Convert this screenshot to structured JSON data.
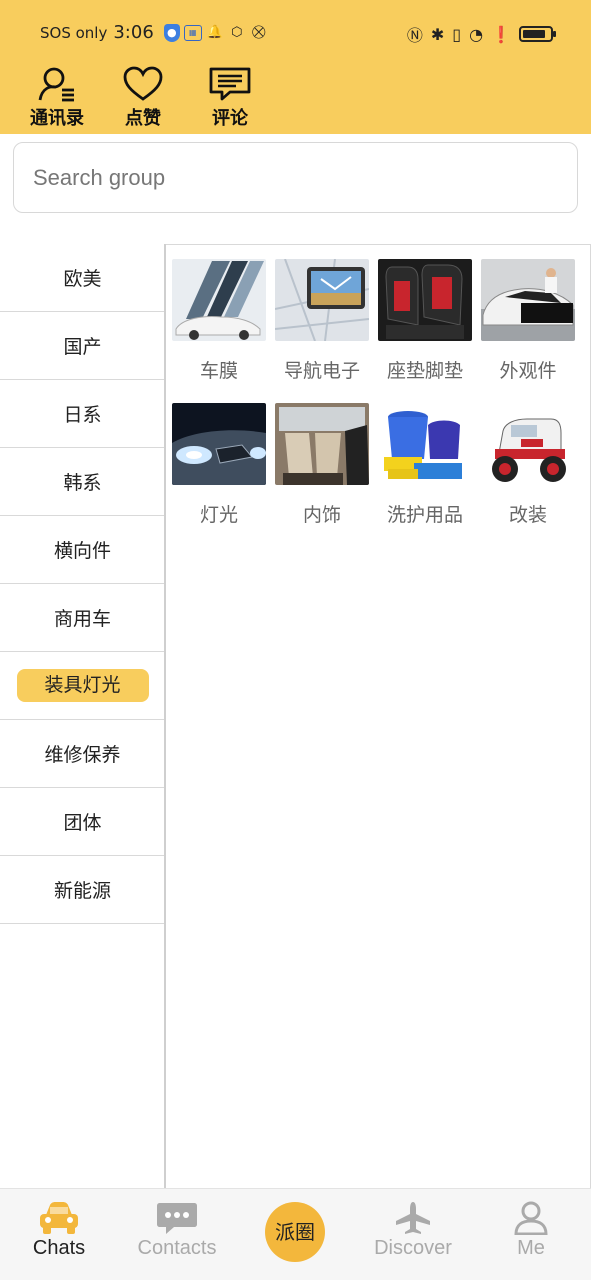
{
  "status_bar": {
    "carrier": "SOS only",
    "time": "3:06"
  },
  "header": {
    "buttons": [
      {
        "label": "通讯录",
        "icon": "contacts-list-icon"
      },
      {
        "label": "点赞",
        "icon": "heart-icon"
      },
      {
        "label": "评论",
        "icon": "comment-icon"
      }
    ]
  },
  "search": {
    "placeholder": "Search group"
  },
  "categories": [
    {
      "label": "欧美"
    },
    {
      "label": "国产"
    },
    {
      "label": "日系"
    },
    {
      "label": "韩系"
    },
    {
      "label": "横向件"
    },
    {
      "label": "商用车"
    },
    {
      "label": "装具灯光",
      "active": true
    },
    {
      "label": "维修保养"
    },
    {
      "label": "团体"
    },
    {
      "label": "新能源"
    }
  ],
  "subcategories": [
    {
      "label": "车膜",
      "icon": "window-film-image"
    },
    {
      "label": "导航电子",
      "icon": "gps-navigator-image"
    },
    {
      "label": "座垫脚垫",
      "icon": "seat-cover-image"
    },
    {
      "label": "外观件",
      "icon": "car-exterior-image"
    },
    {
      "label": "灯光",
      "icon": "headlight-image"
    },
    {
      "label": "内饰",
      "icon": "car-interior-image"
    },
    {
      "label": "洗护用品",
      "icon": "wash-kit-image"
    },
    {
      "label": "改装",
      "icon": "modified-car-image"
    }
  ],
  "bottom_nav": {
    "items": [
      {
        "label": "Chats",
        "icon": "car-icon",
        "active": true
      },
      {
        "label": "Contacts",
        "icon": "chat-bubble-icon"
      },
      {
        "label": "派圈",
        "icon": "center-circle"
      },
      {
        "label": "Discover",
        "icon": "airplane-icon"
      },
      {
        "label": "Me",
        "icon": "person-icon"
      }
    ]
  },
  "colors": {
    "accent": "#f8cd5d",
    "center_button": "#f3b73c",
    "nav_active": "#f3b73c",
    "nav_inactive": "#aaaaaa"
  }
}
